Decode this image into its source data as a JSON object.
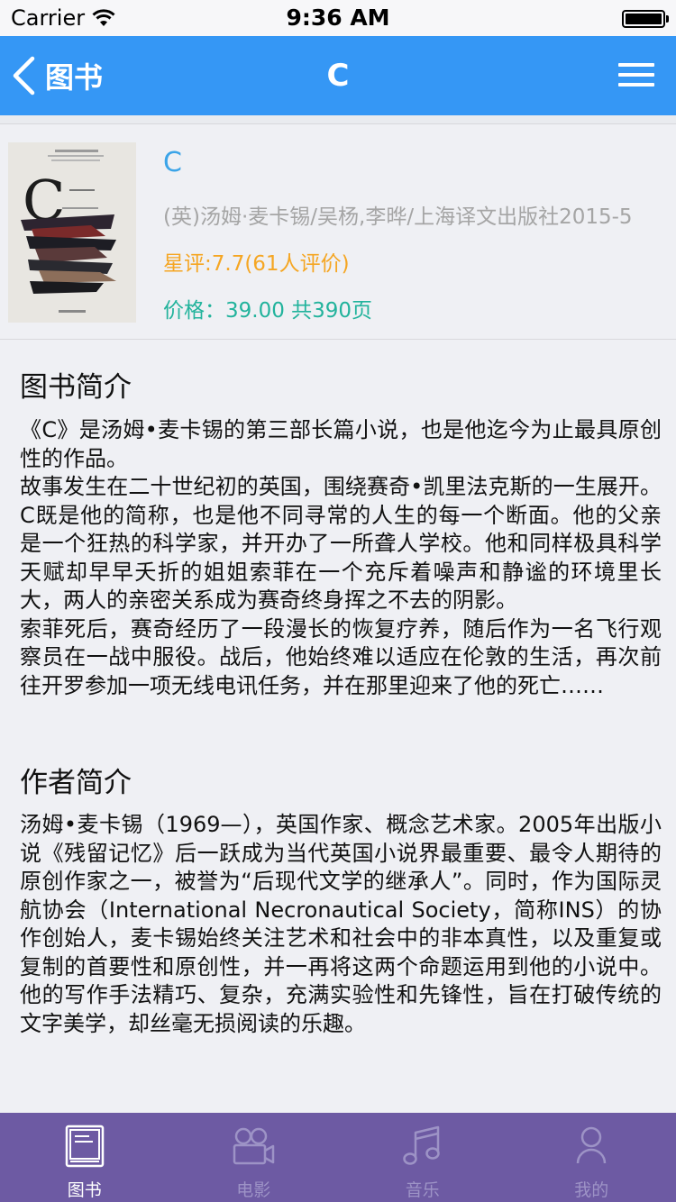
{
  "status_bar": {
    "carrier": "Carrier",
    "time": "9:36 AM"
  },
  "nav": {
    "back_label": "图书",
    "title": "C"
  },
  "book": {
    "title": "C",
    "meta": "(英)汤姆·麦卡锡/吴杨,李晔/上海译文出版社2015-5",
    "rating": "星评:7.7(61人评价)",
    "price": "价格：39.00 共390页"
  },
  "intro": {
    "heading": "图书简介",
    "text": "《C》是汤姆•麦卡锡的第三部长篇小说，也是他迄今为止最具原创性的作品。\n故事发生在二十世纪初的英国，围绕赛奇•凯里法克斯的一生展开。C既是他的简称，也是他不同寻常的人生的每一个断面。他的父亲是一个狂热的科学家，并开办了一所聋人学校。他和同样极具科学天赋却早早夭折的姐姐索菲在一个充斥着噪声和静谧的环境里长大，两人的亲密关系成为赛奇终身挥之不去的阴影。\n索菲死后，赛奇经历了一段漫长的恢复疗养，随后作为一名飞行观察员在一战中服役。战后，他始终难以适应在伦敦的生活，再次前往开罗参加一项无线电讯任务，并在那里迎来了他的死亡……"
  },
  "author": {
    "heading": "作者简介",
    "text": "汤姆•麦卡锡（1969—），英国作家、概念艺术家。2005年出版小说《残留记忆》后一跃成为当代英国小说界最重要、最令人期待的原创作家之一，被誉为“后现代文学的继承人”。同时，作为国际灵航协会（International Necronautical Society，简称INS）的协作创始人，麦卡锡始终关注艺术和社会中的非本真性，以及重复或复制的首要性和原创性，并一再将这两个命题运用到他的小说中。他的写作手法精巧、复杂，充满实验性和先锋性，旨在打破传统的文字美学，却丝毫无损阅读的乐趣。"
  },
  "tabs": [
    {
      "label": "图书",
      "icon": "book-icon",
      "active": true
    },
    {
      "label": "电影",
      "icon": "movie-camera-icon",
      "active": false
    },
    {
      "label": "音乐",
      "icon": "music-note-icon",
      "active": false
    },
    {
      "label": "我的",
      "icon": "user-icon",
      "active": false
    }
  ],
  "colors": {
    "nav": "#3597f5",
    "tab_bar": "#6d5aa3",
    "title": "#3ba4e8",
    "rating": "#f5a623",
    "price": "#22b39c"
  }
}
